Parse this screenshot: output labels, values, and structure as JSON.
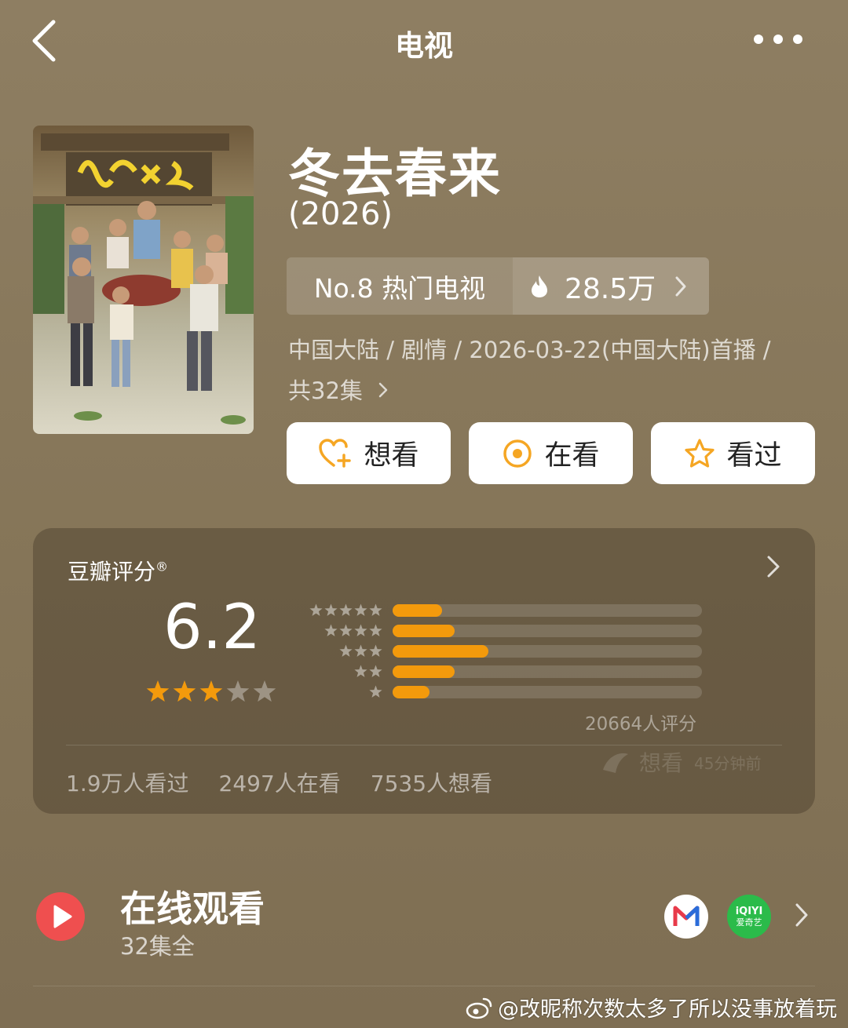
{
  "header": {
    "title": "电视"
  },
  "show": {
    "poster_title": "冬去春来",
    "title": "冬去春来",
    "year": "(2026)",
    "rank_label": "No.8 热门电视",
    "heat": "28.5万",
    "meta_line": "中国大陆 / 剧情 / 2026-03-22(中国大陆)首播 /",
    "episodes_link": "共32集"
  },
  "actions": [
    {
      "label": "想看",
      "icon": "heart-plus-icon"
    },
    {
      "label": "在看",
      "icon": "target-circle-icon"
    },
    {
      "label": "看过",
      "icon": "star-outline-icon"
    }
  ],
  "rating": {
    "title": "豆瓣评分",
    "trademark": "®",
    "score": "6.2",
    "stars": 3,
    "distribution": [
      {
        "stars": 5,
        "fraction": 0.16
      },
      {
        "stars": 4,
        "fraction": 0.2
      },
      {
        "stars": 3,
        "fraction": 0.31
      },
      {
        "stars": 2,
        "fraction": 0.2
      },
      {
        "stars": 1,
        "fraction": 0.12
      }
    ],
    "count_text": "20664人评分",
    "watermark_text": "想看",
    "watermark_time": "45分钟前",
    "stats": [
      "1.9万人看过",
      "2497人在看",
      "7535人想看"
    ]
  },
  "online": {
    "title": "在线观看",
    "subtitle": "32集全",
    "platforms": [
      {
        "name": "mango-tv",
        "icon": "mango-tv-logo-icon"
      },
      {
        "name": "iqiyi",
        "logo_text": "iQIYI",
        "logo_sub": "爱奇艺"
      }
    ]
  },
  "watermark": {
    "text": "@改昵称次数太多了所以没事放着玩"
  },
  "colors": {
    "accent": "#f39a0c",
    "play": "#ef4f4f",
    "iqiyi": "#2bbb4a"
  }
}
